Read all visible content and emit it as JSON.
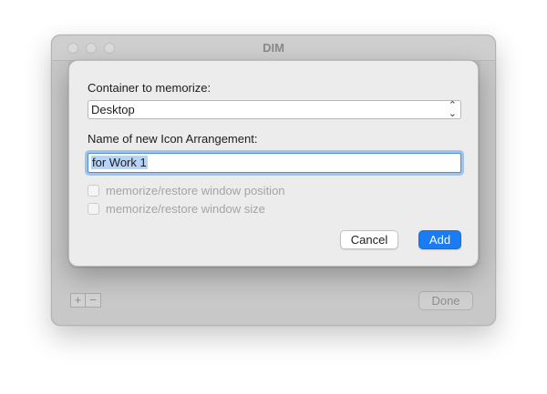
{
  "window": {
    "title": "DIM",
    "footer": {
      "add_label": "+",
      "remove_label": "−",
      "done_label": "Done"
    }
  },
  "sheet": {
    "container_label": "Container to memorize:",
    "container_select": {
      "selected": "Desktop"
    },
    "name_label": "Name of new Icon Arrangement:",
    "name_input": {
      "value": "for Work 1"
    },
    "options": [
      {
        "label": "memorize/restore window position",
        "checked": false,
        "enabled": false
      },
      {
        "label": "memorize/restore window size",
        "checked": false,
        "enabled": false
      }
    ],
    "cancel_label": "Cancel",
    "add_label": "Add"
  },
  "colors": {
    "accent": "#1a7bf2",
    "focus_ring": "#4a90e2",
    "selection": "#b5d4f8"
  }
}
